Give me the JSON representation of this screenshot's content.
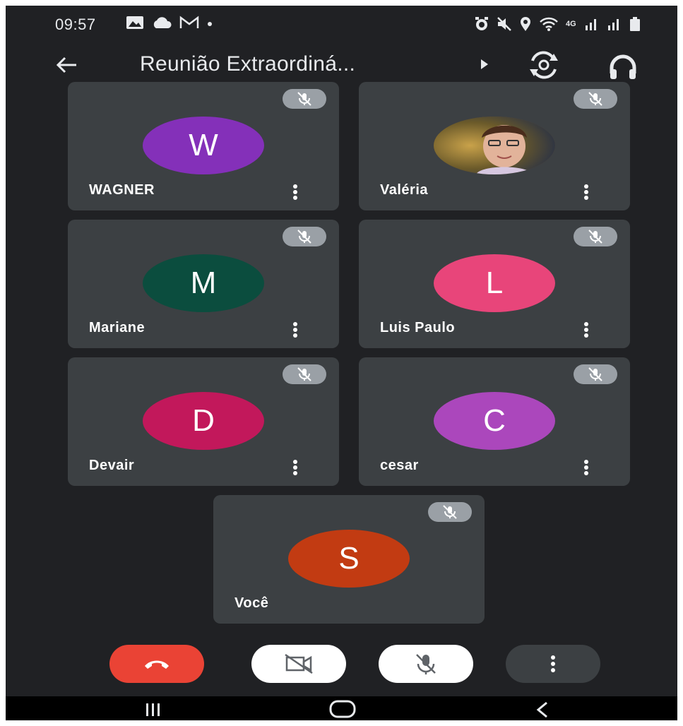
{
  "status_bar": {
    "time": "09:57",
    "left_icons": [
      "gallery-icon",
      "cloud-icon",
      "gmail-icon",
      "dot-icon"
    ],
    "right_icons": [
      "alarm-icon",
      "mute-icon",
      "location-icon",
      "wifi-icon",
      "4g-icon",
      "signal-icon",
      "signal-icon",
      "battery-icon"
    ],
    "network_label": "4G"
  },
  "top_bar": {
    "title": "Reunião Extraordiná..."
  },
  "participants": [
    {
      "name": "WAGNER",
      "initial": "W",
      "color": "#8430b9",
      "muted": true
    },
    {
      "name": "Valéria",
      "initial": "",
      "color": "#6b4a2a",
      "muted": true,
      "has_photo": true
    },
    {
      "name": "Mariane",
      "initial": "M",
      "color": "#0b4d3e",
      "muted": true
    },
    {
      "name": "Luis Paulo",
      "initial": "L",
      "color": "#e8457a",
      "muted": true
    },
    {
      "name": "Devair",
      "initial": "D",
      "color": "#c2185b",
      "muted": true
    },
    {
      "name": "cesar",
      "initial": "C",
      "color": "#ab47bc",
      "muted": true
    },
    {
      "name": "Você",
      "initial": "S",
      "color": "#c23b12",
      "muted": true
    }
  ],
  "controls": {
    "end_call_color": "#ea4335",
    "camera_off_color": "#ffffff",
    "mic_off_color": "#ffffff",
    "more_color": "#3c4043"
  }
}
